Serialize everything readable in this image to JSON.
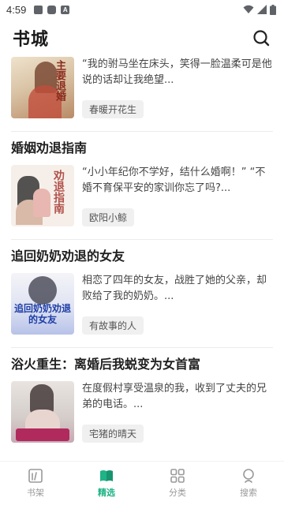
{
  "status_bar": {
    "time": "4:59",
    "icons": [
      "image-icon",
      "notification-icon",
      "a-icon",
      "wifi-icon",
      "signal-icon",
      "battery-icon"
    ]
  },
  "header": {
    "title": "书城",
    "search_icon": "search-icon"
  },
  "books": [
    {
      "title": "",
      "description": "“我的驸马坐在床头，笑得一脸温柔可是他说的话却让我绝望...",
      "author": "春暖开花生",
      "cover": {
        "text": "主要退婚",
        "palette": [
          "#d9c3a5",
          "#7a4a35"
        ]
      }
    },
    {
      "title": "婚姻劝退指南",
      "description": "“小小年纪你不学好，结什么婚啊！” “不婚不育保平安的家训你忘了吗?...",
      "author": "欧阳小鲸",
      "cover": {
        "text": "劝退指南",
        "palette": [
          "#f4ede6",
          "#b2524c"
        ]
      }
    },
    {
      "title": "追回奶奶劝退的女友",
      "description": "相恋了四年的女友，战胜了她的父亲，却败给了我的奶奶。...",
      "author": "有故事的人",
      "cover": {
        "text": "追回奶奶劝退的女友",
        "palette": [
          "#e6e9f5",
          "#2a4fb5"
        ]
      }
    },
    {
      "title": "浴火重生：离婚后我蜕变为女首富",
      "description": "在度假村享受温泉的我，收到了丈夫的兄弟的电话。...",
      "author": "宅猪的晴天",
      "cover": {
        "text": "",
        "palette": [
          "#d7d2cf",
          "#b02a5d"
        ]
      }
    }
  ],
  "bottom_nav": {
    "items": [
      {
        "label": "书架",
        "icon": "bookshelf-icon",
        "active": false
      },
      {
        "label": "精选",
        "icon": "open-book-icon",
        "active": true
      },
      {
        "label": "分类",
        "icon": "grid-icon",
        "active": false
      },
      {
        "label": "搜索",
        "icon": "person-search-icon",
        "active": false
      }
    ]
  },
  "colors": {
    "accent": "#1fb385",
    "inactive": "#999999",
    "tag_bg": "#f0f0f0"
  }
}
